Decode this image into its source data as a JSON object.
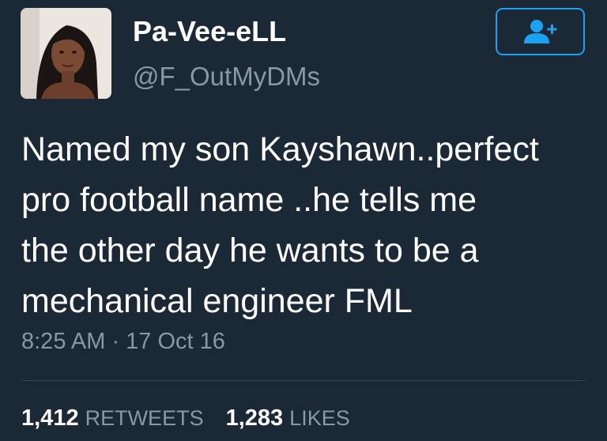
{
  "user": {
    "display_name": "Pa-Vee-eLL",
    "handle": "@F_OutMyDMs",
    "avatar_icon": "profile-photo"
  },
  "follow_button": {
    "icon": "add-user-icon",
    "color": "#1da1f2"
  },
  "tweet": {
    "text_lines": [
      "Named my son Kayshawn..perfect",
      "pro football name ..he tells me",
      "the other day he wants to be a",
      "mechanical engineer FML"
    ],
    "timestamp": "8:25 AM · 17 Oct 16"
  },
  "stats": {
    "retweets_count": "1,412",
    "retweets_label": "RETWEETS",
    "likes_count": "1,283",
    "likes_label": "LIKES"
  },
  "theme": {
    "background": "#1b2836",
    "text_primary": "#ffffff",
    "text_secondary": "#8899a6",
    "accent": "#1da1f2"
  }
}
